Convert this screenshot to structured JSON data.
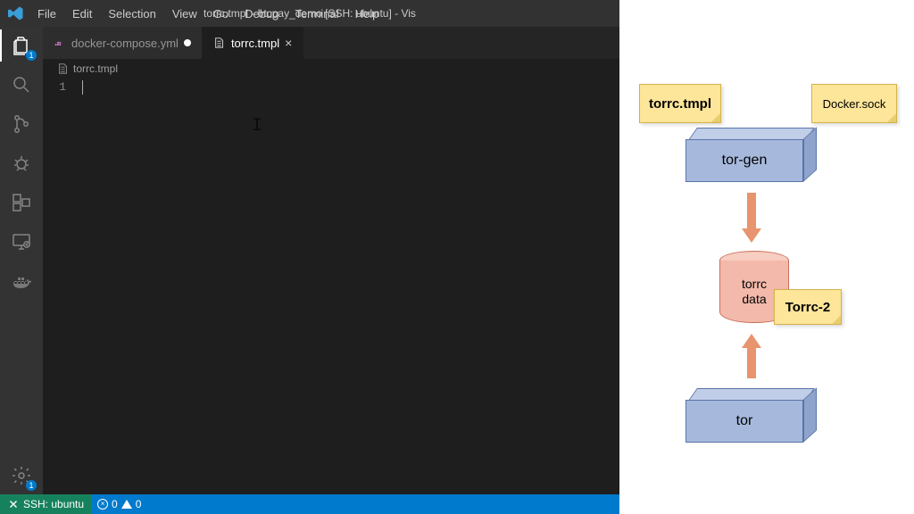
{
  "title": "torrc.tmpl - btcpay_demo [SSH: ubuntu] - Vis",
  "menu": [
    "File",
    "Edit",
    "Selection",
    "View",
    "Go",
    "Debug",
    "Terminal",
    "Help"
  ],
  "activity_badge_explorer": "1",
  "activity_badge_settings": "1",
  "tabs": [
    {
      "label": "docker-compose.yml",
      "dirty": true,
      "active": false
    },
    {
      "label": "torrc.tmpl",
      "dirty": false,
      "active": true
    }
  ],
  "breadcrumb": "torrc.tmpl",
  "line_number": "1",
  "status": {
    "remote": "SSH: ubuntu",
    "errors": "0",
    "warnings": "0"
  },
  "diagram": {
    "note_torrc": "torrc.tmpl",
    "note_docker": "Docker.sock",
    "box_torgen": "tor-gen",
    "cyl_line1": "torrc",
    "cyl_line2": "data",
    "note_torrc2": "Torrc-2",
    "box_tor": "tor"
  }
}
